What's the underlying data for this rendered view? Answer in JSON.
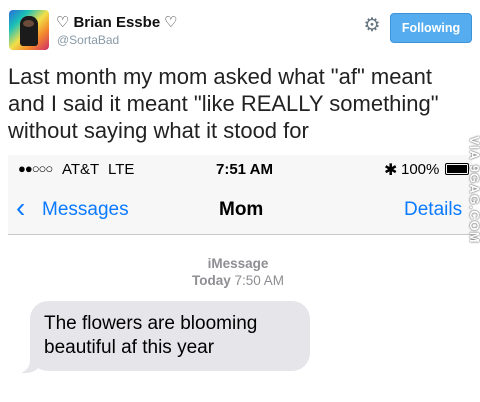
{
  "tweet": {
    "display_name": "Brian Essbe",
    "name_icon": "white-heart",
    "handle": "@SortaBad",
    "settings_icon": "gear-icon",
    "follow_label": "Following",
    "text": "Last month my mom asked what \"af\" meant and I said it meant \"like REALLY something\" without saying what it stood for"
  },
  "phone": {
    "status_bar": {
      "signal": "●●○○○",
      "carrier": "AT&T",
      "network": "LTE",
      "time": "7:51 AM",
      "bluetooth_icon": "bluetooth-icon",
      "battery": "100%"
    },
    "nav": {
      "back_label": "Messages",
      "title": "Mom",
      "details_label": "Details"
    },
    "thread": {
      "service_label": "iMessage",
      "day": "Today",
      "time": "7:50 AM",
      "message": "The flowers are blooming beautiful af this year"
    }
  },
  "watermark": "VIA 9GAG.COM",
  "colors": {
    "follow_button": "#55acee",
    "ios_blue": "#0a7aff",
    "received_bubble": "#e5e5ea"
  }
}
